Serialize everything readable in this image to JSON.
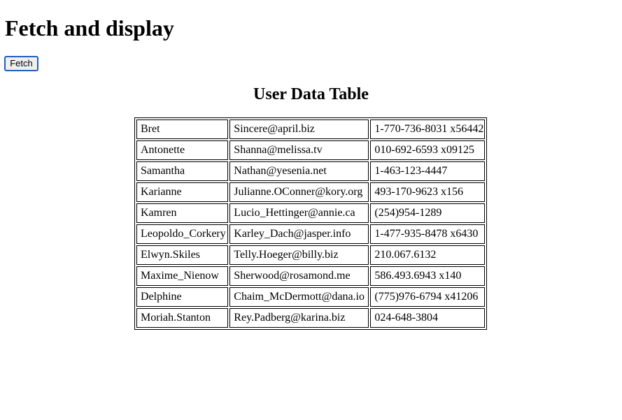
{
  "page": {
    "heading": "Fetch and display",
    "fetch_button_label": "Fetch",
    "table_title": "User Data Table"
  },
  "users": [
    {
      "username": "Bret",
      "email": "Sincere@april.biz",
      "phone": "1-770-736-8031 x56442"
    },
    {
      "username": "Antonette",
      "email": "Shanna@melissa.tv",
      "phone": "010-692-6593 x09125"
    },
    {
      "username": "Samantha",
      "email": "Nathan@yesenia.net",
      "phone": "1-463-123-4447"
    },
    {
      "username": "Karianne",
      "email": "Julianne.OConner@kory.org",
      "phone": "493-170-9623 x156"
    },
    {
      "username": "Kamren",
      "email": "Lucio_Hettinger@annie.ca",
      "phone": "(254)954-1289"
    },
    {
      "username": "Leopoldo_Corkery",
      "email": "Karley_Dach@jasper.info",
      "phone": "1-477-935-8478 x6430"
    },
    {
      "username": "Elwyn.Skiles",
      "email": "Telly.Hoeger@billy.biz",
      "phone": "210.067.6132"
    },
    {
      "username": "Maxime_Nienow",
      "email": "Sherwood@rosamond.me",
      "phone": "586.493.6943 x140"
    },
    {
      "username": "Delphine",
      "email": "Chaim_McDermott@dana.io",
      "phone": "(775)976-6794 x41206"
    },
    {
      "username": "Moriah.Stanton",
      "email": "Rey.Padberg@karina.biz",
      "phone": "024-648-3804"
    }
  ]
}
